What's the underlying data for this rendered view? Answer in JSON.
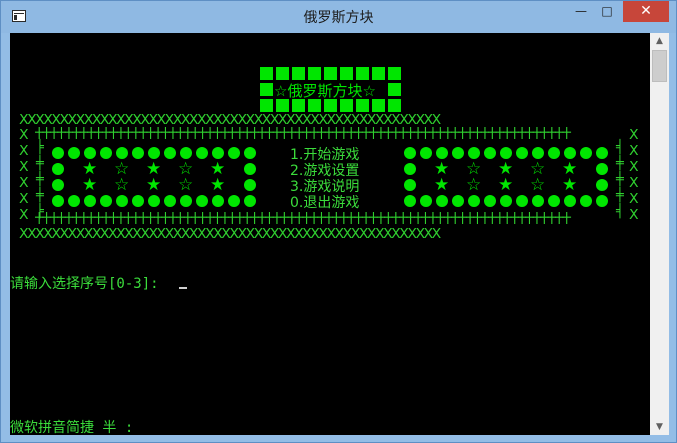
{
  "window": {
    "title": "俄罗斯方块",
    "minimize": "—",
    "maximize": "□",
    "close": "✕"
  },
  "banner": {
    "title": "☆俄罗斯方块☆"
  },
  "menu": [
    "1.开始游戏",
    "2.游戏设置",
    "3.游戏说明",
    "0.退出游戏"
  ],
  "prompt": "请输入选择序号[0-3]: ",
  "ime": "微软拼音简捷 半 :",
  "colors": {
    "console_bg": "#000000",
    "text_green": "#00e600"
  },
  "icons": [
    "app-icon",
    "scroll-up-icon",
    "scroll-down-icon"
  ]
}
